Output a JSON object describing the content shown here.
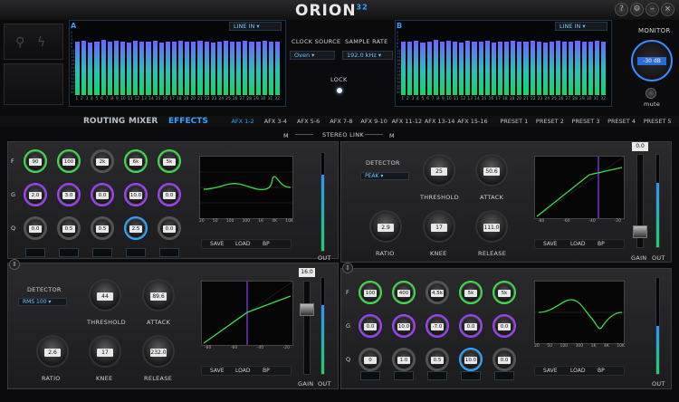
{
  "app": {
    "logo_text": "ORION",
    "logo_superscript": "32"
  },
  "window_buttons": [
    "?",
    "⚙",
    "–",
    "×"
  ],
  "meters": {
    "left": {
      "channel_label": "A",
      "source": "LINE IN",
      "scale": [
        "0",
        "2",
        "4",
        "6",
        "8",
        "10",
        "12",
        "14",
        "16",
        "18",
        "20",
        "24",
        "28",
        "32",
        "36",
        "40",
        "50",
        "60"
      ],
      "levels": [
        0.84,
        0.86,
        0.83,
        0.85,
        0.87,
        0.84,
        0.86,
        0.85,
        0.83,
        0.86,
        0.84,
        0.85,
        0.86,
        0.83,
        0.85,
        0.84,
        0.86,
        0.85,
        0.84,
        0.86,
        0.85,
        0.83,
        0.84,
        0.86,
        0.85,
        0.84,
        0.86,
        0.85,
        0.84,
        0.86,
        0.85,
        0.84
      ]
    },
    "right": {
      "channel_label": "B",
      "source": "LINE IN",
      "scale": [
        "0",
        "2",
        "4",
        "6",
        "8",
        "10",
        "12",
        "14",
        "16",
        "18",
        "20",
        "24",
        "28",
        "32",
        "36",
        "40",
        "50",
        "60"
      ],
      "levels": [
        0.85,
        0.84,
        0.86,
        0.83,
        0.85,
        0.87,
        0.84,
        0.86,
        0.85,
        0.83,
        0.86,
        0.84,
        0.85,
        0.86,
        0.83,
        0.85,
        0.84,
        0.86,
        0.85,
        0.84,
        0.86,
        0.85,
        0.83,
        0.84,
        0.86,
        0.85,
        0.84,
        0.86,
        0.85,
        0.84,
        0.86,
        0.85
      ]
    },
    "channel_numbers": [
      "1",
      "2",
      "3",
      "4",
      "5",
      "6",
      "7",
      "8",
      "9",
      "10",
      "11",
      "12",
      "13",
      "14",
      "15",
      "16",
      "17",
      "18",
      "19",
      "20",
      "21",
      "22",
      "23",
      "24",
      "25",
      "26",
      "27",
      "28",
      "29",
      "30",
      "31",
      "32"
    ]
  },
  "clock": {
    "source_label": "CLOCK SOURCE",
    "source_value": "Oven",
    "rate_label": "SAMPLE RATE",
    "rate_value": "192.0 kHz",
    "lock_label": "LOCK"
  },
  "monitor": {
    "label": "MONITOR",
    "value": "-30 dB",
    "mute_label": "mute"
  },
  "main_tabs": [
    {
      "label": "ROUTING"
    },
    {
      "label": "MIXER"
    },
    {
      "label": "EFFECTS",
      "active": true
    }
  ],
  "afx_tabs": [
    {
      "label": "AFX 1-2",
      "active": true
    },
    {
      "label": "AFX 3-4"
    },
    {
      "label": "AFX 5-6"
    },
    {
      "label": "AFX 7-8"
    },
    {
      "label": "AFX 9-10"
    },
    {
      "label": "AFX 11-12"
    },
    {
      "label": "AFX 13-14"
    },
    {
      "label": "AFX 15-16"
    }
  ],
  "presets": [
    "PRESET 1",
    "PRESET 2",
    "PRESET 3",
    "PRESET 4",
    "PRESET 5"
  ],
  "stereo_link": {
    "label": "STEREO LINK",
    "m_left": "M",
    "m_right": "M"
  },
  "eq_left": {
    "row_labels": [
      "F",
      "G",
      "Q"
    ],
    "rows": [
      [
        "90",
        "100",
        "2k",
        "6k",
        "5k"
      ],
      [
        "2.0",
        "3.0",
        "0.0",
        "10.0",
        "0.0"
      ],
      [
        "0.0",
        "0.5",
        "0.5",
        "2.5",
        "0.0"
      ]
    ],
    "graph_x_ticks": [
      "20",
      "50",
      "100",
      "300",
      "1K",
      "4K",
      "10K"
    ],
    "graph_y_ticks": [
      "20",
      "0",
      "-20"
    ],
    "buttons": [
      "SAVE",
      "LOAD",
      "BP"
    ],
    "out_label": "OUT"
  },
  "comp_left": {
    "detector_label": "DETECTOR",
    "detector_value": "RMS 100",
    "threshold_label": "THRESHOLD",
    "threshold_value": "44",
    "attack_label": "ATTACK",
    "attack_value": "89.6",
    "ratio_label": "RATIO",
    "ratio_value": "2.6",
    "knee_label": "KNEE",
    "knee_value": "17",
    "release_label": "RELEASE",
    "release_value": "232.0",
    "graph_x_ticks": [
      "-80",
      "-60",
      "-40",
      "-20"
    ],
    "graph_y_ticks": [
      "-20",
      "-40",
      "-60",
      "-80"
    ],
    "buttons": [
      "SAVE",
      "LOAD",
      "BP"
    ],
    "gain_value": "16.0",
    "gain_label": "GAIN",
    "out_label": "OUT"
  },
  "comp_right": {
    "detector_label": "DETECTOR",
    "detector_value": "PEAK",
    "threshold_label": "THRESHOLD",
    "threshold_value": "25",
    "attack_label": "ATTACK",
    "attack_value": "50.6",
    "ratio_label": "RATIO",
    "ratio_value": "2.9",
    "knee_label": "KNEE",
    "knee_value": "17",
    "release_label": "RELEASE",
    "release_value": "111.0",
    "graph_x_ticks": [
      "-80",
      "-60",
      "-40",
      "-20"
    ],
    "graph_y_ticks": [
      "-20",
      "-40",
      "-60",
      "-80"
    ],
    "buttons": [
      "SAVE",
      "LOAD",
      "BP"
    ],
    "gain_value": "0.0",
    "gain_label": "GAIN",
    "out_label": "OUT"
  },
  "eq_right": {
    "row_labels": [
      "F",
      "G",
      "Q"
    ],
    "rows": [
      [
        "100",
        "400",
        "4.5k",
        "5k",
        "5k"
      ],
      [
        "0.0",
        "10.0",
        "-7.0",
        "0.0",
        "0.0"
      ],
      [
        "0",
        "1.0",
        "0.5",
        "10.0",
        "0.0"
      ]
    ],
    "graph_x_ticks": [
      "20",
      "50",
      "100",
      "300",
      "1K",
      "4K",
      "10K"
    ],
    "graph_y_ticks": [
      "20",
      "0",
      "-20"
    ],
    "buttons": [
      "SAVE",
      "LOAD",
      "BP"
    ],
    "out_label": "OUT"
  },
  "colors": {
    "accent": "#2aa8ff",
    "meter_green": "#17d36a",
    "meter_purple": "#6f63ff",
    "ring_green": "#3ddc4a",
    "ring_purple": "#a13fff"
  }
}
